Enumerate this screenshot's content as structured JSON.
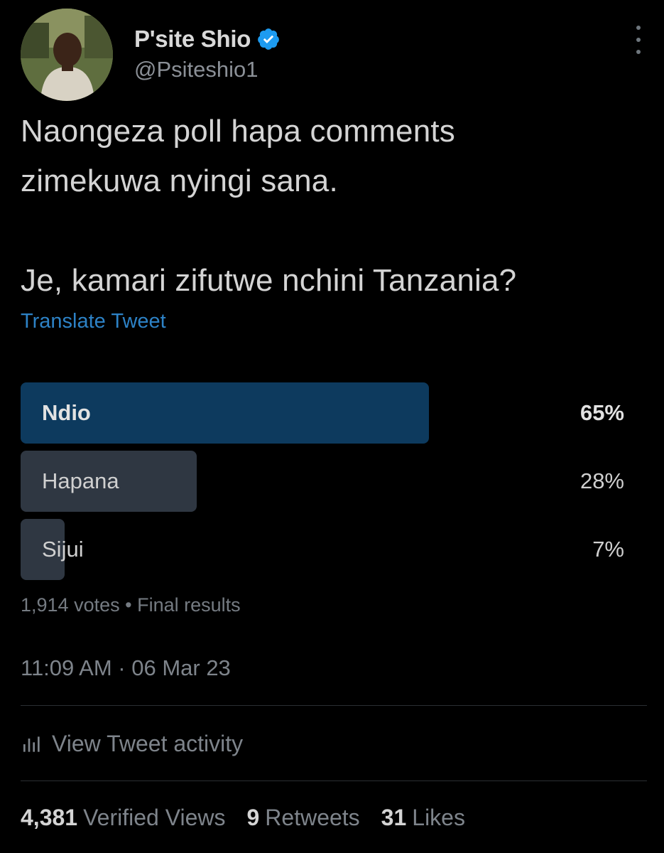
{
  "author": {
    "display_name": "P'site Shio",
    "handle": "@Psiteshio1",
    "verified": true
  },
  "tweet": {
    "text": "Naongeza poll hapa comments\nzimekuwa nyingi sana.\n\nJe, kamari zifutwe nchini Tanzania?",
    "translate_label": "Translate Tweet"
  },
  "poll": {
    "options": [
      {
        "label": "Ndio",
        "percent_text": "65%",
        "percent": 65,
        "winner": true
      },
      {
        "label": "Hapana",
        "percent_text": "28%",
        "percent": 28,
        "winner": false
      },
      {
        "label": "Sijui",
        "percent_text": "7%",
        "percent": 7,
        "winner": false
      }
    ],
    "votes": "1,914 votes",
    "separator": "•",
    "status": "Final results"
  },
  "timestamp": "11:09 AM · 06 Mar 23",
  "activity": {
    "label": "View Tweet activity",
    "icon": "bar-chart-icon"
  },
  "stats": [
    {
      "count": "4,381",
      "label": "Verified Views"
    },
    {
      "count": "9",
      "label": "Retweets"
    },
    {
      "count": "31",
      "label": "Likes"
    }
  ],
  "colors": {
    "background": "#000000",
    "link": "#2d82c6",
    "verified_badge": "#1d9bf0",
    "poll_winner": "#0d3a5e",
    "poll_other": "#2f3742",
    "muted_text": "#7e848b"
  }
}
